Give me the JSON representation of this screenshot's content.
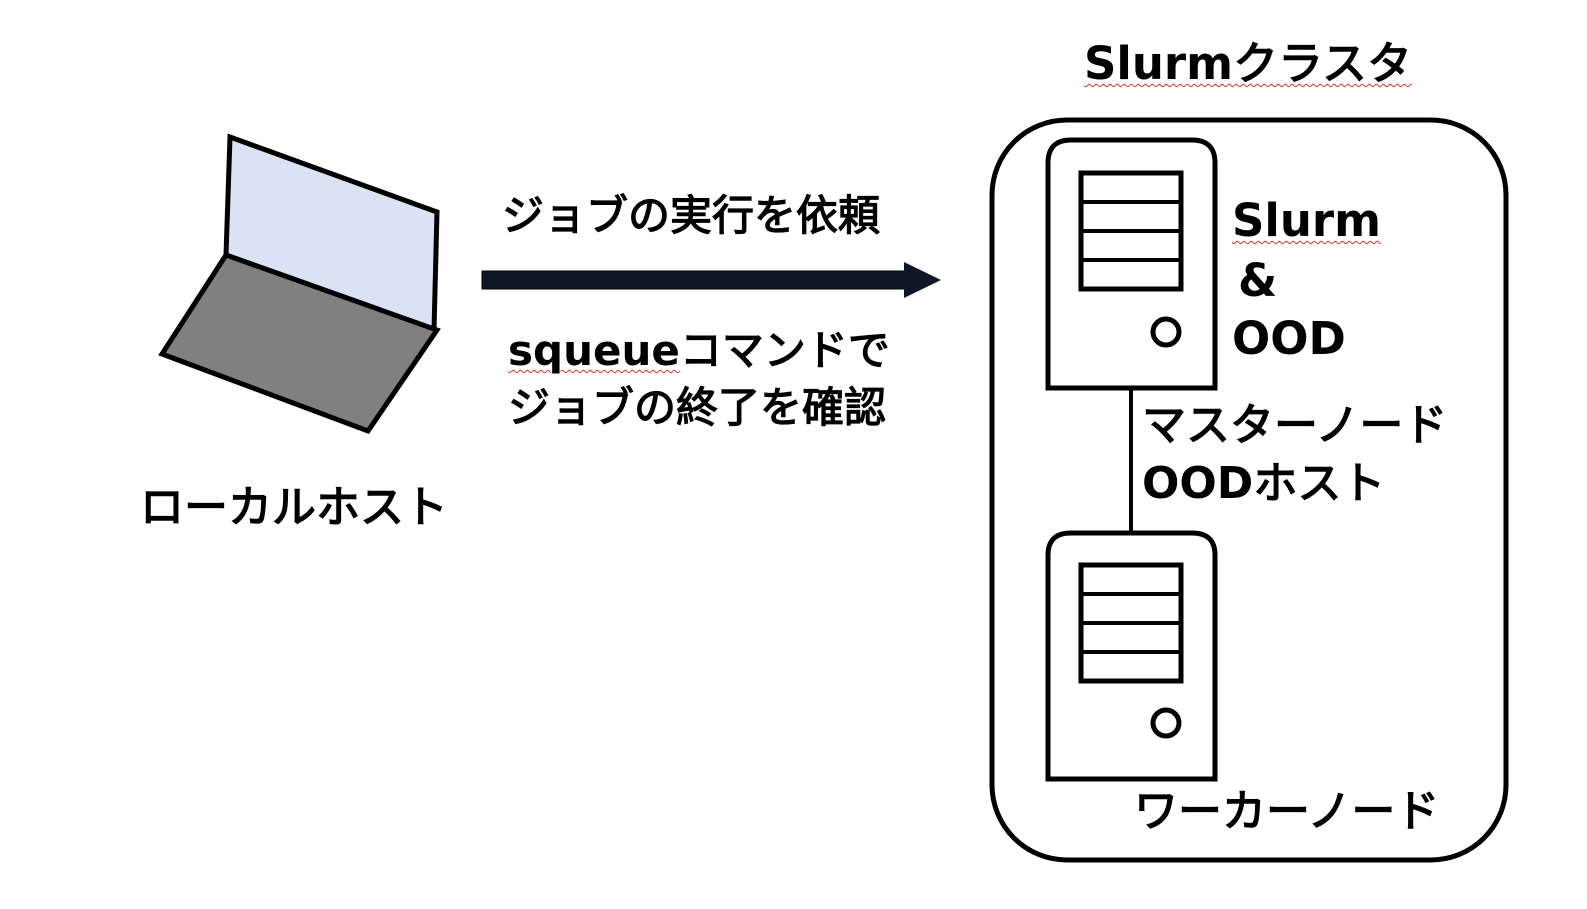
{
  "diagram": {
    "cluster_title": "Slurmクラスタ",
    "request_label": "ジョブの実行を依頼",
    "check_label_line1_cmd": "squeue",
    "check_label_line1_rest": "コマンドで",
    "check_label_line2": "ジョブの終了を確認",
    "localhost_label": "ローカルホスト",
    "master_server_label": {
      "line1": "Slurm",
      "line2": "&",
      "line3": "OOD"
    },
    "master_node_label": "マスターノード",
    "ood_host_label": "OODホスト",
    "worker_node_label": "ワーカーノード"
  },
  "colors": {
    "laptop_screen": "#dae3f3",
    "laptop_base": "#808080",
    "arrow": "#0e1726",
    "outline": "#000000",
    "spellcheck_squiggle": "#d9342b"
  },
  "icons": {
    "client": "laptop-icon",
    "master": "server-tower-icon",
    "worker": "server-tower-icon",
    "connection": "right-arrow-icon"
  }
}
